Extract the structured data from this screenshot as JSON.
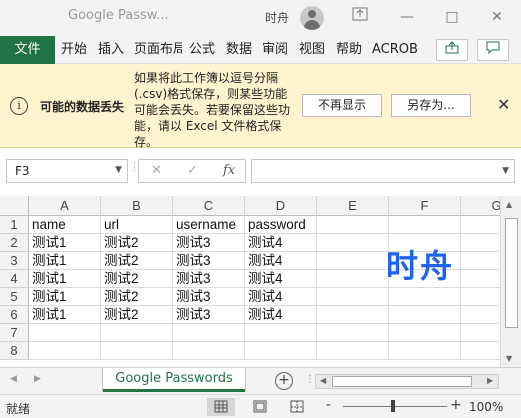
{
  "titlebar": {
    "title": "Google Passw...",
    "user": "时舟",
    "minimize": "—",
    "maximize": "□",
    "close": "✕"
  },
  "ribbon": {
    "tabs": [
      "文件",
      "开始",
      "插入",
      "页面布局",
      "公式",
      "数据",
      "审阅",
      "视图",
      "帮助",
      "ACROB"
    ],
    "share_icon": "share-icon",
    "comment_icon": "comment-icon"
  },
  "messagebar": {
    "title": "可能的数据丢失",
    "text": "如果将此工作簿以逗号分隔(.csv)格式保存，则某些功能可能会丢失。若要保留这些功能，请以 Excel 文件格式保存。",
    "dont_show_button": "不再显示",
    "save_as_button": "另存为..."
  },
  "formula_bar": {
    "name_box": "F3",
    "cancel": "✕",
    "enter": "✓",
    "fx": "fx",
    "formula": ""
  },
  "grid": {
    "corner": "",
    "columns": [
      "A",
      "B",
      "C",
      "D",
      "E",
      "F",
      "G"
    ],
    "rows": [
      "1",
      "2",
      "3",
      "4",
      "5",
      "6",
      "7",
      "8"
    ],
    "cells": [
      [
        "name",
        "url",
        "username",
        "password",
        "",
        "",
        ""
      ],
      [
        "测试1",
        "测试2",
        "测试3",
        "测试4",
        "",
        "",
        ""
      ],
      [
        "测试1",
        "测试2",
        "测试3",
        "测试4",
        "",
        "",
        ""
      ],
      [
        "测试1",
        "测试2",
        "测试3",
        "测试4",
        "",
        "",
        ""
      ],
      [
        "测试1",
        "测试2",
        "测试3",
        "测试4",
        "",
        "",
        ""
      ],
      [
        "测试1",
        "测试2",
        "测试3",
        "测试4",
        "",
        "",
        ""
      ],
      [
        "",
        "",
        "",
        "",
        "",
        "",
        ""
      ],
      [
        "",
        "",
        "",
        "",
        "",
        "",
        ""
      ]
    ],
    "watermark": "时舟"
  },
  "sheets": {
    "active": "Google Passwords",
    "add": "+"
  },
  "statusbar": {
    "status": "就绪",
    "zoom_minus": "-",
    "zoom_plus": "+",
    "zoom": "100%"
  },
  "colors": {
    "accent": "#217346",
    "warning_bg": "#fff4ce",
    "watermark": "#1e63f0"
  }
}
